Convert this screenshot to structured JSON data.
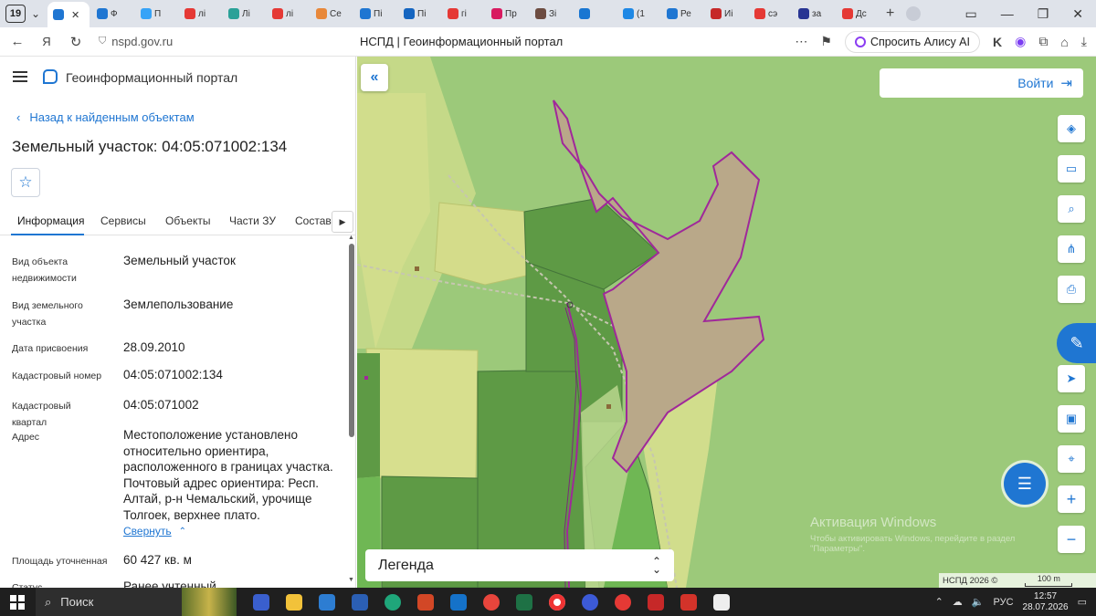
{
  "browser": {
    "tab_count": "19",
    "tabs": [
      {
        "label": "",
        "color": "#1f76d2",
        "active": true
      },
      {
        "label": "Ф",
        "color": "#1f76d2"
      },
      {
        "label": "П",
        "color": "#36a3f7"
      },
      {
        "label": "лі",
        "color": "#e53935"
      },
      {
        "label": "Лі",
        "color": "#2aa198"
      },
      {
        "label": "лі",
        "color": "#e53935"
      },
      {
        "label": "Се",
        "color": "#e8883a"
      },
      {
        "label": "Пі",
        "color": "#1f76d2"
      },
      {
        "label": "Пі",
        "color": "#1565c0"
      },
      {
        "label": "гі",
        "color": "#e53935"
      },
      {
        "label": "Пр",
        "color": "#d81b60"
      },
      {
        "label": "Зі",
        "color": "#6d4c41"
      },
      {
        "label": "",
        "color": "#1976d2"
      },
      {
        "label": "(1",
        "color": "#1e88e5"
      },
      {
        "label": "Ре",
        "color": "#1f76d2"
      },
      {
        "label": "Иі",
        "color": "#c62828"
      },
      {
        "label": "сэ",
        "color": "#e53935"
      },
      {
        "label": "за",
        "color": "#283593"
      },
      {
        "label": "Дс",
        "color": "#e53935"
      }
    ],
    "url": "nspd.gov.ru",
    "page_title": "НСПД | Геоинформационный портал",
    "alice_label": "Спросить Алису AI"
  },
  "sidebar": {
    "portal_name": "Геоинформационный портал",
    "back_label": "Назад к найденным объектам",
    "object_title": "Земельный участок: 04:05:071002:134",
    "tabs": [
      "Информация",
      "Сервисы",
      "Объекты",
      "Части ЗУ",
      "Состав"
    ],
    "properties": [
      {
        "label": "Вид объекта недвижимости",
        "value": "Земельный участок"
      },
      {
        "label": "Вид земельного участка",
        "value": "Землепользование"
      },
      {
        "label": "Дата присвоения",
        "value": "28.09.2010"
      },
      {
        "label": "Кадастровый номер",
        "value": "04:05:071002:134"
      },
      {
        "label": "Кадастровый квартал",
        "value": "04:05:071002"
      },
      {
        "label": "Адрес",
        "value": "Местоположение установлено относительно ориентира, расположенного в границах участка. Почтовый адрес ориентира: Респ. Алтай, р-н Чемальский, урочище Толгоек, верхнее плато."
      },
      {
        "label": "Площадь уточненная",
        "value": "60 427 кв. м"
      },
      {
        "label": "Статус",
        "value": "Ранее учтенный"
      }
    ],
    "collapse_label": "Свернуть"
  },
  "map": {
    "login_label": "Войти",
    "legend_label": "Легенда",
    "watermark_title": "Активация Windows",
    "watermark_text": "Чтобы активировать Windows, перейдите в раздел \"Параметры\".",
    "attribution": "НСПД 2026 ©",
    "scale_label": "100 m",
    "colors": {
      "base": "#9cc97a",
      "parcel_fill": "#b9a889",
      "parcel_stroke": "#a0289a",
      "dark_green": "#5e9a45",
      "yellow": "#d7df8e"
    }
  },
  "taskbar": {
    "search_label": "Поиск",
    "lang": "РУС",
    "time": "12:57",
    "date": "28.07.2026"
  }
}
